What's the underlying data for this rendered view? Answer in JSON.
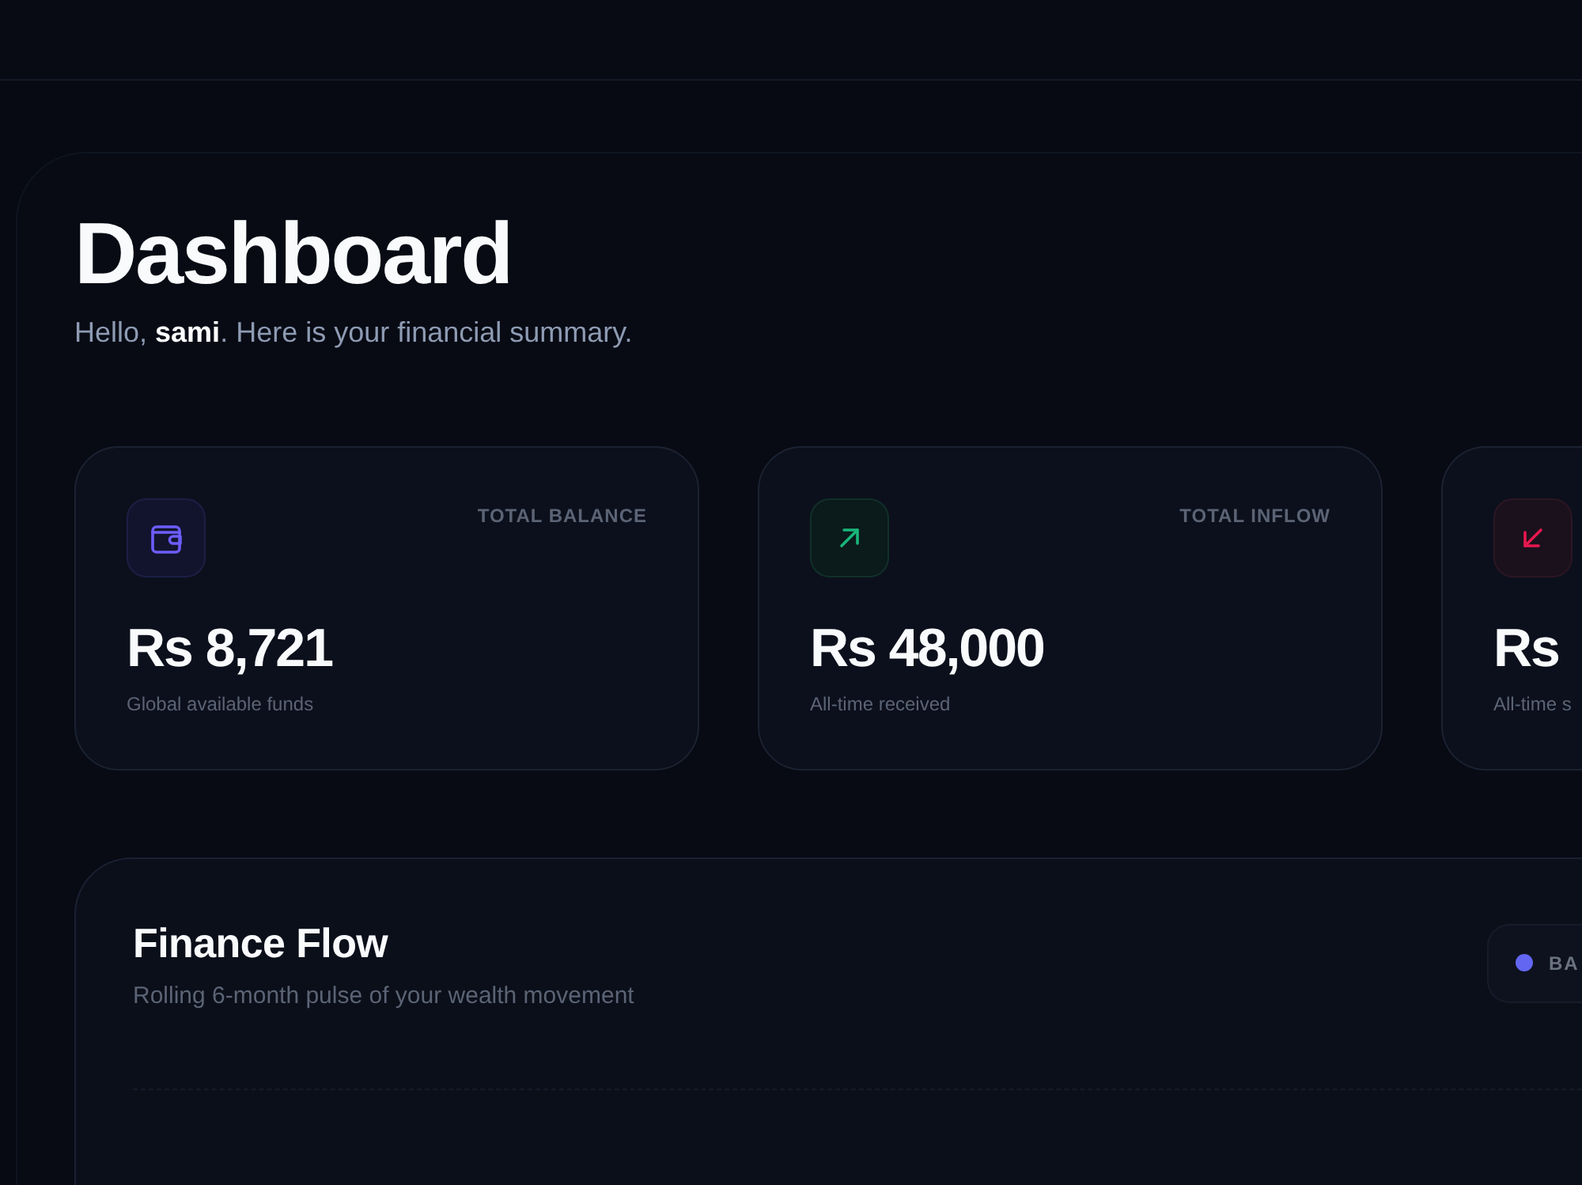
{
  "page": {
    "title": "Dashboard",
    "greeting": "Hello, **sami**. Here is your financial summary."
  },
  "stat_cards": [
    {
      "kind": "balance",
      "label": "TOTAL BALANCE",
      "amount": "Rs 8,721",
      "caption": "Global available funds"
    },
    {
      "kind": "inflow",
      "label": "TOTAL INFLOW",
      "amount": "Rs 48,000",
      "caption": "All-time received"
    },
    {
      "kind": "outflow",
      "amount": "Rs",
      "caption": "All-time s"
    }
  ],
  "finance_flow": {
    "title": "Finance Flow",
    "subtitle": "Rolling 6-month pulse of your wealth movement",
    "legend": [
      {
        "label": "BA",
        "color": "#6366f1"
      }
    ]
  }
}
